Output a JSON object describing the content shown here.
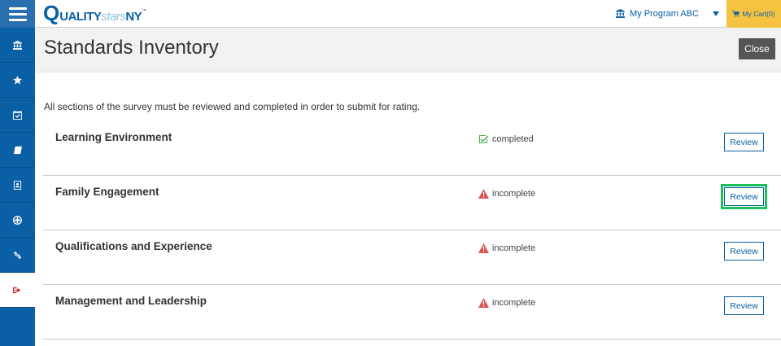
{
  "header": {
    "logo": {
      "q": "Q",
      "uality": "UALITY",
      "stars": "stars",
      "ny": "NY",
      "tm": "™"
    },
    "program_label": "My Program ABC",
    "cart_label": "My Cart(0)"
  },
  "sidebar": {
    "items": [
      {
        "name": "sidebar-item-program",
        "icon": "bank-icon"
      },
      {
        "name": "sidebar-item-rating",
        "icon": "star-icon"
      },
      {
        "name": "sidebar-item-calendar",
        "icon": "calendar-check-icon"
      },
      {
        "name": "sidebar-item-resources",
        "icon": "book-icon"
      },
      {
        "name": "sidebar-item-documents",
        "icon": "portrait-icon"
      },
      {
        "name": "sidebar-item-web",
        "icon": "globe-icon"
      },
      {
        "name": "sidebar-item-links",
        "icon": "link-icon"
      },
      {
        "name": "sidebar-item-logout",
        "icon": "sign-out-icon"
      }
    ]
  },
  "page": {
    "title": "Standards Inventory",
    "close_label": "Close",
    "intro": "All sections of the survey must be reviewed and completed in order to submit for rating."
  },
  "sections": [
    {
      "name": "Learning Environment",
      "status": "completed",
      "status_type": "completed",
      "action": "Review"
    },
    {
      "name": "Family Engagement",
      "status": "incomplete",
      "status_type": "incomplete",
      "action": "Review"
    },
    {
      "name": "Qualifications and Experience",
      "status": "incomplete",
      "status_type": "incomplete",
      "action": "Review"
    },
    {
      "name": "Management and Leadership",
      "status": "incomplete",
      "status_type": "incomplete",
      "action": "Review"
    }
  ],
  "colors": {
    "brand_blue": "#0b5fa5",
    "cart_yellow": "#f5c242",
    "completed_green": "#4caf50",
    "warning_red": "#d9534f",
    "focus_green": "#1bbf5c"
  }
}
